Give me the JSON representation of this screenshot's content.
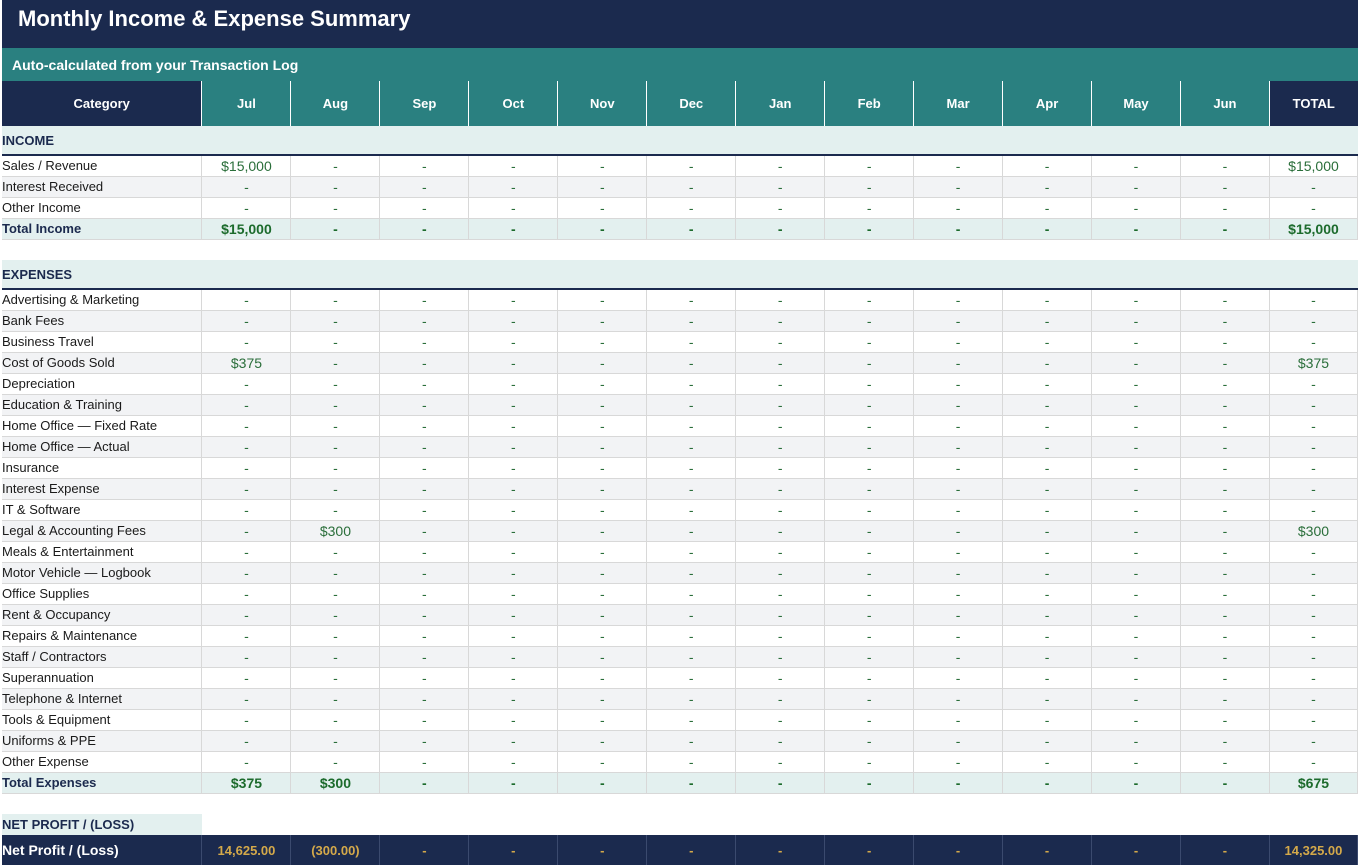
{
  "title": "Monthly Income & Expense Summary",
  "subtitle": "Auto-calculated from your Transaction Log",
  "header": {
    "category": "Category",
    "months": [
      "Jul",
      "Aug",
      "Sep",
      "Oct",
      "Nov",
      "Dec",
      "Jan",
      "Feb",
      "Mar",
      "Apr",
      "May",
      "Jun"
    ],
    "total": "TOTAL"
  },
  "income": {
    "section_label": "INCOME",
    "rows": [
      {
        "label": "Sales / Revenue",
        "values": [
          "$15,000",
          "-",
          "-",
          "-",
          "-",
          "-",
          "-",
          "-",
          "-",
          "-",
          "-",
          "-"
        ],
        "total": "$15,000"
      },
      {
        "label": "Interest Received",
        "values": [
          "-",
          "-",
          "-",
          "-",
          "-",
          "-",
          "-",
          "-",
          "-",
          "-",
          "-",
          "-"
        ],
        "total": "-"
      },
      {
        "label": "Other Income",
        "values": [
          "-",
          "-",
          "-",
          "-",
          "-",
          "-",
          "-",
          "-",
          "-",
          "-",
          "-",
          "-"
        ],
        "total": "-"
      }
    ],
    "total_row": {
      "label": "Total Income",
      "values": [
        "$15,000",
        "-",
        "-",
        "-",
        "-",
        "-",
        "-",
        "-",
        "-",
        "-",
        "-",
        "-"
      ],
      "total": "$15,000"
    }
  },
  "expenses": {
    "section_label": "EXPENSES",
    "rows": [
      {
        "label": "Advertising & Marketing",
        "values": [
          "-",
          "-",
          "-",
          "-",
          "-",
          "-",
          "-",
          "-",
          "-",
          "-",
          "-",
          "-"
        ],
        "total": "-"
      },
      {
        "label": "Bank Fees",
        "values": [
          "-",
          "-",
          "-",
          "-",
          "-",
          "-",
          "-",
          "-",
          "-",
          "-",
          "-",
          "-"
        ],
        "total": "-"
      },
      {
        "label": "Business Travel",
        "values": [
          "-",
          "-",
          "-",
          "-",
          "-",
          "-",
          "-",
          "-",
          "-",
          "-",
          "-",
          "-"
        ],
        "total": "-"
      },
      {
        "label": "Cost of Goods Sold",
        "values": [
          "$375",
          "-",
          "-",
          "-",
          "-",
          "-",
          "-",
          "-",
          "-",
          "-",
          "-",
          "-"
        ],
        "total": "$375"
      },
      {
        "label": "Depreciation",
        "values": [
          "-",
          "-",
          "-",
          "-",
          "-",
          "-",
          "-",
          "-",
          "-",
          "-",
          "-",
          "-"
        ],
        "total": "-"
      },
      {
        "label": "Education & Training",
        "values": [
          "-",
          "-",
          "-",
          "-",
          "-",
          "-",
          "-",
          "-",
          "-",
          "-",
          "-",
          "-"
        ],
        "total": "-"
      },
      {
        "label": "Home Office — Fixed Rate",
        "values": [
          "-",
          "-",
          "-",
          "-",
          "-",
          "-",
          "-",
          "-",
          "-",
          "-",
          "-",
          "-"
        ],
        "total": "-"
      },
      {
        "label": "Home Office — Actual",
        "values": [
          "-",
          "-",
          "-",
          "-",
          "-",
          "-",
          "-",
          "-",
          "-",
          "-",
          "-",
          "-"
        ],
        "total": "-"
      },
      {
        "label": "Insurance",
        "values": [
          "-",
          "-",
          "-",
          "-",
          "-",
          "-",
          "-",
          "-",
          "-",
          "-",
          "-",
          "-"
        ],
        "total": "-"
      },
      {
        "label": "Interest Expense",
        "values": [
          "-",
          "-",
          "-",
          "-",
          "-",
          "-",
          "-",
          "-",
          "-",
          "-",
          "-",
          "-"
        ],
        "total": "-"
      },
      {
        "label": "IT & Software",
        "values": [
          "-",
          "-",
          "-",
          "-",
          "-",
          "-",
          "-",
          "-",
          "-",
          "-",
          "-",
          "-"
        ],
        "total": "-"
      },
      {
        "label": "Legal & Accounting Fees",
        "values": [
          "-",
          "$300",
          "-",
          "-",
          "-",
          "-",
          "-",
          "-",
          "-",
          "-",
          "-",
          "-"
        ],
        "total": "$300"
      },
      {
        "label": "Meals & Entertainment",
        "values": [
          "-",
          "-",
          "-",
          "-",
          "-",
          "-",
          "-",
          "-",
          "-",
          "-",
          "-",
          "-"
        ],
        "total": "-"
      },
      {
        "label": "Motor Vehicle — Logbook",
        "values": [
          "-",
          "-",
          "-",
          "-",
          "-",
          "-",
          "-",
          "-",
          "-",
          "-",
          "-",
          "-"
        ],
        "total": "-"
      },
      {
        "label": "Office Supplies",
        "values": [
          "-",
          "-",
          "-",
          "-",
          "-",
          "-",
          "-",
          "-",
          "-",
          "-",
          "-",
          "-"
        ],
        "total": "-"
      },
      {
        "label": "Rent & Occupancy",
        "values": [
          "-",
          "-",
          "-",
          "-",
          "-",
          "-",
          "-",
          "-",
          "-",
          "-",
          "-",
          "-"
        ],
        "total": "-"
      },
      {
        "label": "Repairs & Maintenance",
        "values": [
          "-",
          "-",
          "-",
          "-",
          "-",
          "-",
          "-",
          "-",
          "-",
          "-",
          "-",
          "-"
        ],
        "total": "-"
      },
      {
        "label": "Staff / Contractors",
        "values": [
          "-",
          "-",
          "-",
          "-",
          "-",
          "-",
          "-",
          "-",
          "-",
          "-",
          "-",
          "-"
        ],
        "total": "-"
      },
      {
        "label": "Superannuation",
        "values": [
          "-",
          "-",
          "-",
          "-",
          "-",
          "-",
          "-",
          "-",
          "-",
          "-",
          "-",
          "-"
        ],
        "total": "-"
      },
      {
        "label": "Telephone & Internet",
        "values": [
          "-",
          "-",
          "-",
          "-",
          "-",
          "-",
          "-",
          "-",
          "-",
          "-",
          "-",
          "-"
        ],
        "total": "-"
      },
      {
        "label": "Tools & Equipment",
        "values": [
          "-",
          "-",
          "-",
          "-",
          "-",
          "-",
          "-",
          "-",
          "-",
          "-",
          "-",
          "-"
        ],
        "total": "-"
      },
      {
        "label": "Uniforms & PPE",
        "values": [
          "-",
          "-",
          "-",
          "-",
          "-",
          "-",
          "-",
          "-",
          "-",
          "-",
          "-",
          "-"
        ],
        "total": "-"
      },
      {
        "label": "Other Expense",
        "values": [
          "-",
          "-",
          "-",
          "-",
          "-",
          "-",
          "-",
          "-",
          "-",
          "-",
          "-",
          "-"
        ],
        "total": "-"
      }
    ],
    "total_row": {
      "label": "Total Expenses",
      "values": [
        "$375",
        "$300",
        "-",
        "-",
        "-",
        "-",
        "-",
        "-",
        "-",
        "-",
        "-",
        "-"
      ],
      "total": "$675"
    }
  },
  "net_profit": {
    "section_label": "NET PROFIT / (LOSS)",
    "row": {
      "label": "Net Profit / (Loss)",
      "values": [
        "14,625.00",
        "(300.00)",
        "-",
        "-",
        "-",
        "-",
        "-",
        "-",
        "-",
        "-",
        "-",
        "-"
      ],
      "total": "14,325.00"
    }
  },
  "colors": {
    "navy": "#1b2a4e",
    "teal": "#2a8080",
    "section_bg": "#e3f0ef",
    "value_green": "#2a6e3a",
    "net_gold": "#d4a94a"
  }
}
